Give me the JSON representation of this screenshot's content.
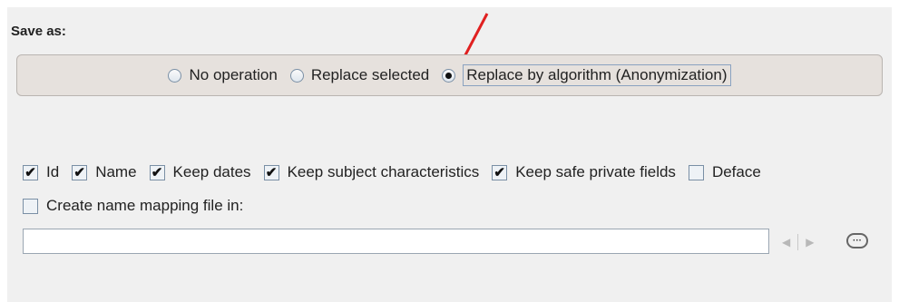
{
  "save_as": {
    "title": "Save as:",
    "options": [
      {
        "label": "No operation",
        "selected": false
      },
      {
        "label": "Replace selected",
        "selected": false
      },
      {
        "label": "Replace by algorithm (Anonymization)",
        "selected": true
      }
    ]
  },
  "options": [
    {
      "label": "Id",
      "checked": true
    },
    {
      "label": "Name",
      "checked": true
    },
    {
      "label": "Keep dates",
      "checked": true
    },
    {
      "label": "Keep subject characteristics",
      "checked": true
    },
    {
      "label": "Keep safe private fields",
      "checked": true
    },
    {
      "label": "Deface",
      "checked": false
    }
  ],
  "mapping": {
    "label": "Create name mapping file in:",
    "checked": false
  },
  "path": {
    "value": ""
  },
  "icons": {
    "back": "back-arrow-icon",
    "forward": "forward-arrow-icon",
    "browse": "browse-icon",
    "annotation": "red-arrow-icon"
  },
  "colors": {
    "annotation_arrow": "#e02020",
    "group_bg": "#e6e1dd",
    "panel_bg": "#f0f0f0"
  }
}
